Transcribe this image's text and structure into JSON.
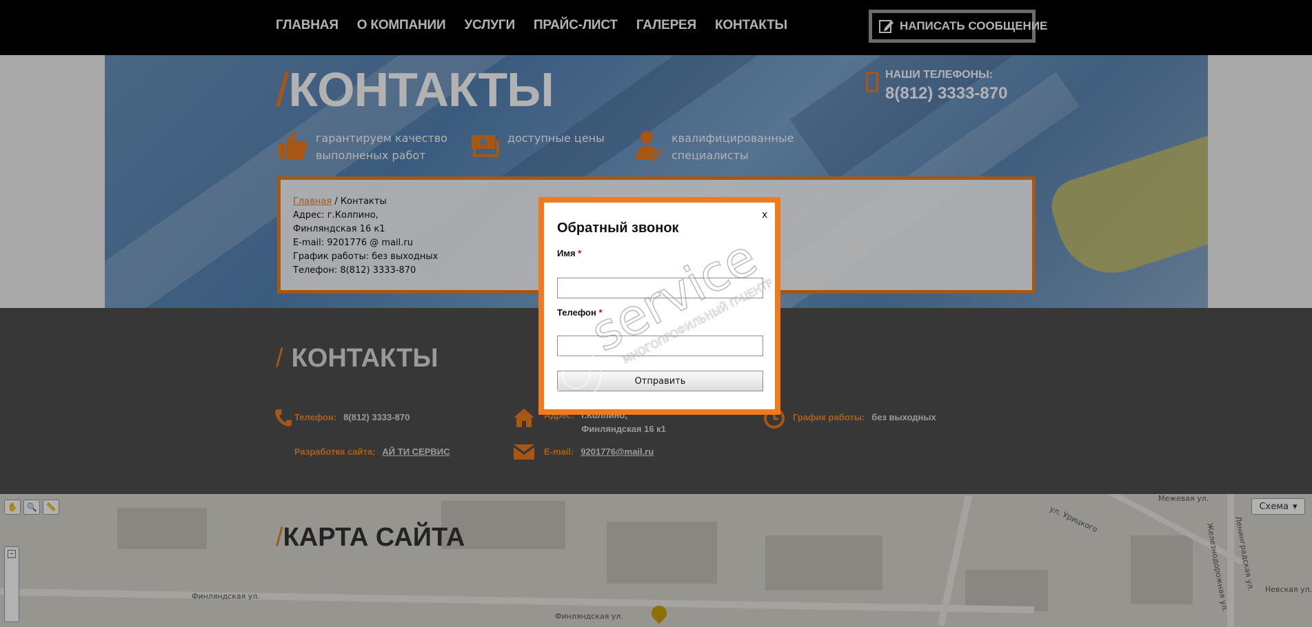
{
  "nav": {
    "items": [
      {
        "label": "ГЛАВНАЯ"
      },
      {
        "label": "О КОМПАНИИ"
      },
      {
        "label": "УСЛУГИ"
      },
      {
        "label": "ПРАЙС-ЛИСТ"
      },
      {
        "label": "ГАЛЕРЕЯ"
      },
      {
        "label": "КОНТАКТЫ"
      }
    ],
    "write_button": "НАПИСАТЬ СООБЩЕНИЕ"
  },
  "hero": {
    "slash": "/",
    "title": "КОНТАКТЫ",
    "phones_label": "НАШИ ТЕЛЕФОНЫ:",
    "phones_number": "8(812) 3333-870",
    "features": [
      {
        "line1": "гарантируем качество",
        "line2": "выполненых работ",
        "icon": "thumbs-up-icon"
      },
      {
        "line1": "доступные цены",
        "line2": "",
        "icon": "money-icon"
      },
      {
        "line1": "квалифицированные",
        "line2": "специалисты",
        "icon": "specialist-icon"
      }
    ]
  },
  "info": {
    "breadcrumb_home": "Главная",
    "breadcrumb_sep": " / ",
    "breadcrumb_current": "Контакты",
    "lines": [
      "Адрес: г.Колпино,",
      "Финляндская 16 к1",
      "E-mail: 9201776 @ mail.ru",
      "График работы: без выходных",
      "Телефон: 8(812) 3333-870"
    ]
  },
  "contacts": {
    "slash": "/",
    "title": "КОНТАКТЫ",
    "phone_label": "Телефон:",
    "phone_value": "8(812) 3333-870",
    "dev_label": "Разработка сайта:",
    "dev_value": "АЙ ТИ СЕРВИС",
    "address_label": "Адрес:",
    "address_line1": "г.Колпино,",
    "address_line2": "Финляндская 16 к1",
    "email_label": "E-mail:",
    "email_value": "9201776@mail.ru",
    "schedule_label": "График работы:",
    "schedule_value": "без выходных"
  },
  "map": {
    "slash": "/",
    "title": "КАРТА САЙТА",
    "scheme_label": "Схема",
    "streets": [
      "Финляндская ул.",
      "Финляндская ул.",
      "Межевая ул.",
      "ул. Урицкого",
      "Железнодорожная ул.",
      "Ленинградская ул.",
      "Невская ул."
    ]
  },
  "modal": {
    "title": "Обратный звонок",
    "close": "x",
    "name_label": "Имя",
    "phone_label": "Телефон",
    "required_mark": "*",
    "submit": "Отправить",
    "name_value": "",
    "phone_value": ""
  },
  "watermark": {
    "brand": "service",
    "tagline": "МНОГОПРОФИЛЬНЫЙ IT-ЦЕНТР"
  },
  "colors": {
    "accent": "#f07b1e",
    "nav_bg": "#000000",
    "contacts_bg": "#4f4f4f"
  }
}
